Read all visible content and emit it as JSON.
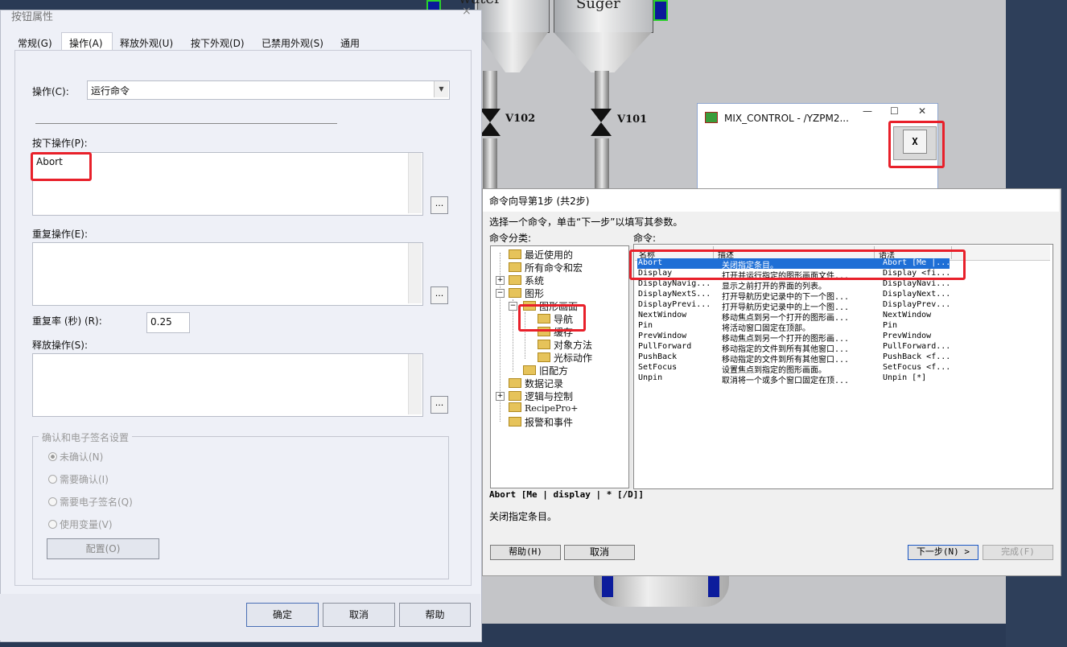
{
  "bg": {
    "tank1_label": "water",
    "tank2_label": "Suger",
    "valve1": "V102",
    "valve2": "V101"
  },
  "mix_window": {
    "title": "MIX_CONTROL - /YZPM2...",
    "minimize": "—",
    "maximize": "☐",
    "close": "✕",
    "button_label": "X"
  },
  "dialog": {
    "title": "按钮属性",
    "close": "×",
    "tabs": [
      "常规(G)",
      "操作(A)",
      "释放外观(U)",
      "按下外观(D)",
      "已禁用外观(S)",
      "通用"
    ],
    "action_label": "操作(C):",
    "action_value": "运行命令",
    "press_label": "按下操作(P):",
    "press_value": "Abort",
    "repeat_label": "重复操作(E):",
    "repeat_value": "",
    "rate_label": "重复率 (秒) (R):",
    "rate_value": "0.25",
    "release_label": "释放操作(S):",
    "release_value": "",
    "dots": "...",
    "group_title": "确认和电子签名设置",
    "radios": [
      "未确认(N)",
      "需要确认(I)",
      "需要电子签名(Q)",
      "使用变量(V)"
    ],
    "config_button": "配置(O)",
    "ok": "确定",
    "cancel": "取消",
    "help": "帮助"
  },
  "wizard": {
    "title": "命令向导第1步 (共2步)",
    "instruction": "选择一个命令，单击“下一步”以填写其参数。",
    "category_label": "命令分类:",
    "command_label": "命令:",
    "tree": [
      "最近使用的",
      "所有命令和宏",
      "系统",
      "图形",
      "图形画面",
      "导航",
      "缓存",
      "对象方法",
      "光标动作",
      "旧配方",
      "数据记录",
      "逻辑与控制",
      "RecipePro+",
      "报警和事件"
    ],
    "columns": [
      "名称",
      "描述",
      "语法"
    ],
    "rows": [
      [
        "Abort",
        "关闭指定条目。",
        "Abort [Me |..."
      ],
      [
        "Display",
        "打开并运行指定的图形画面文件...",
        "Display <fi..."
      ],
      [
        "DisplayNavig...",
        "显示之前打开的界面的列表。",
        "DisplayNavi..."
      ],
      [
        "DisplayNextS...",
        "打开导航历史记录中的下一个图...",
        "DisplayNext..."
      ],
      [
        "DisplayPrevi...",
        "打开导航历史记录中的上一个图...",
        "DisplayPrev..."
      ],
      [
        "NextWindow",
        "移动焦点到另一个打开的图形画...",
        "NextWindow"
      ],
      [
        "Pin",
        "将活动窗口固定在顶部。",
        "Pin"
      ],
      [
        "PrevWindow",
        "移动焦点到另一个打开的图形画...",
        "PrevWindow"
      ],
      [
        "PullForward",
        "移动指定的文件到所有其他窗口...",
        "PullForward..."
      ],
      [
        "PushBack",
        "移动指定的文件到所有其他窗口...",
        "PushBack <f..."
      ],
      [
        "SetFocus",
        "设置焦点到指定的图形画面。",
        "SetFocus <f..."
      ],
      [
        "Unpin",
        "取消将一个或多个窗口固定在顶...",
        "Unpin [*]"
      ]
    ],
    "syntax": "Abort [Me | display | * [/D]]",
    "description": "关闭指定条目。",
    "help_button": "帮助(H)",
    "cancel_button": "取消",
    "next_button": "下一步(N) >",
    "finish_button": "完成(F)"
  }
}
